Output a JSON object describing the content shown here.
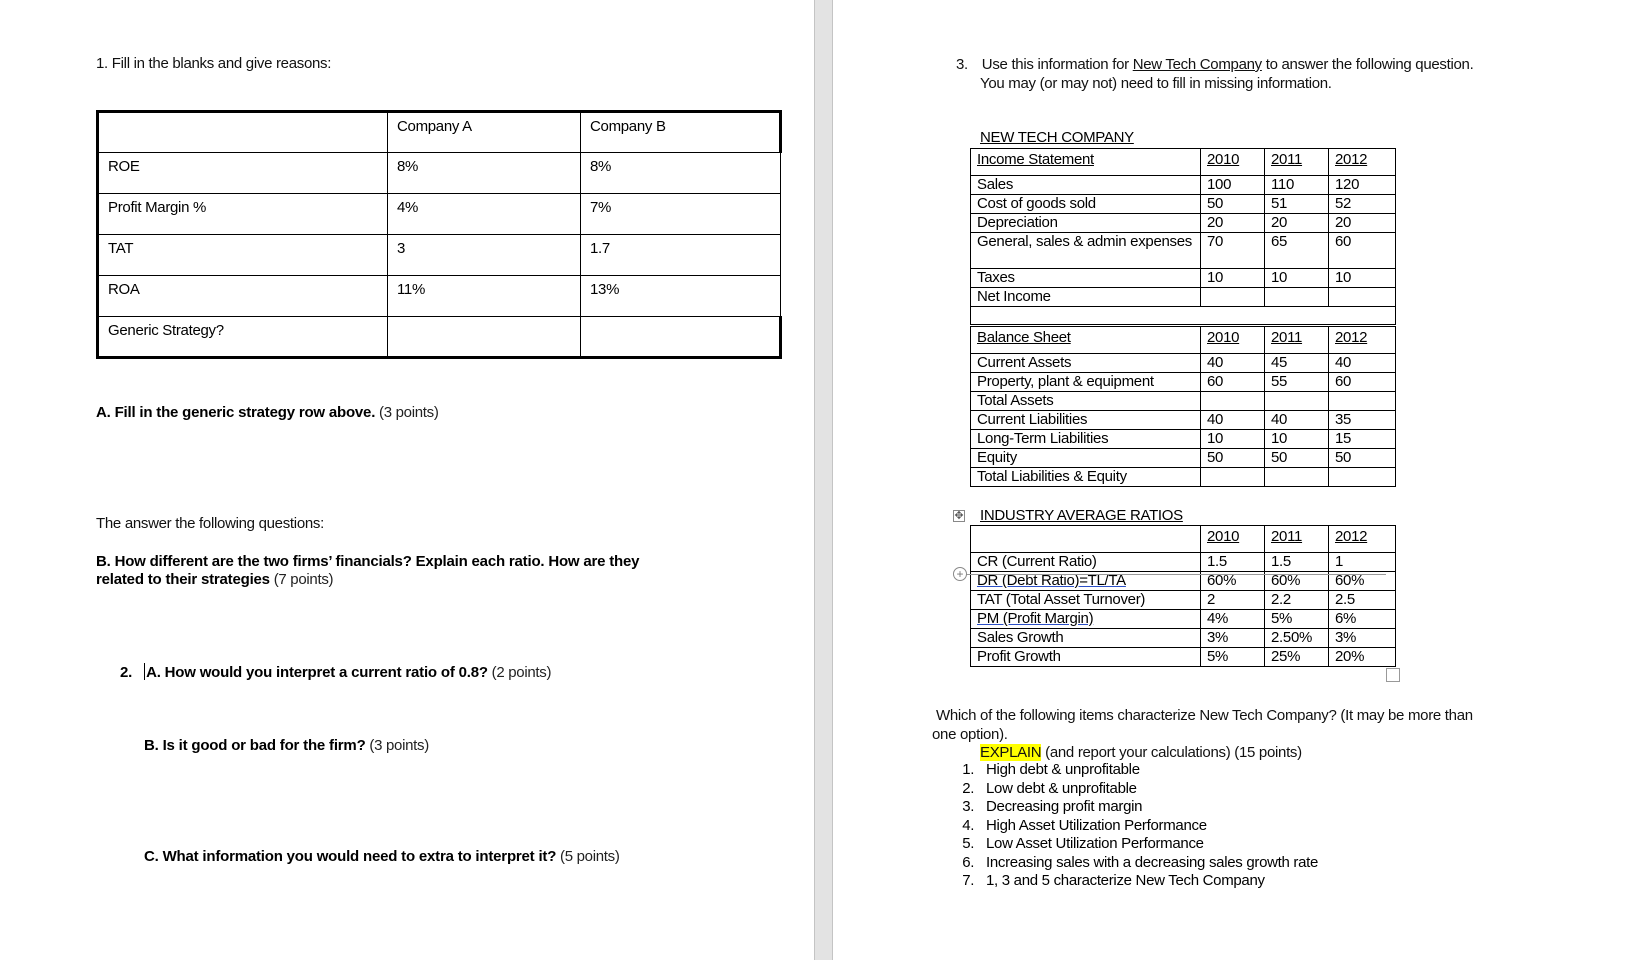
{
  "left_page": {
    "q1_heading": "1.  Fill in the blanks and give reasons:",
    "q1_table": {
      "headers": [
        "",
        "Company A",
        "Company B"
      ],
      "rows": [
        [
          "ROE",
          "8%",
          "8%"
        ],
        [
          "Profit Margin %",
          "4%",
          "7%"
        ],
        [
          "TAT",
          "3",
          "1.7"
        ],
        [
          "ROA",
          "11%",
          "13%"
        ],
        [
          "Generic Strategy?",
          "",
          ""
        ]
      ]
    },
    "q1a": {
      "bold": "A. Fill in the generic strategy row above.",
      "points": " (3 points)"
    },
    "intro": "The answer the following questions:",
    "q1b": {
      "bold_line1": "B. How different are the two firms’ financials? Explain each ratio. How are they",
      "bold_line2": "related to their  strategies",
      "points": " (7 points)"
    },
    "q2a": {
      "number": "2.",
      "bold": "A. How would you interpret  a current ratio of 0.8?",
      "points": "  (2 points)"
    },
    "q2b": {
      "bold": "B. Is it good or bad for the firm?",
      "points": " (3 points)"
    },
    "q2c": {
      "bold": "C. What information  you would need to extra to interpret it?",
      "points": " (5 points)"
    }
  },
  "right_page": {
    "q3_number": "3.",
    "q3_line1_pre": "Use this information for ",
    "q3_company_link": "New Tech Company",
    "q3_line1_post": " to answer the following question.",
    "q3_line2": "You may (or may not) need to fill in missing information.",
    "company_title": "NEW TECH COMPANY",
    "income_statement": {
      "headers": [
        "Income Statement",
        "2010",
        "2011",
        "2012"
      ],
      "rows": [
        [
          "Sales",
          "100",
          "110",
          "120"
        ],
        [
          "Cost of goods sold",
          "50",
          "51",
          "52"
        ],
        [
          "Depreciation",
          "20",
          "20",
          "20"
        ],
        [
          "General, sales & admin expenses",
          "70",
          "65",
          "60"
        ],
        [
          "Taxes",
          "10",
          "10",
          "10"
        ],
        [
          "Net Income",
          "",
          "",
          ""
        ]
      ]
    },
    "balance_sheet": {
      "headers": [
        "Balance Sheet",
        "2010",
        "2011",
        "2012"
      ],
      "rows": [
        [
          "Current Assets",
          "40",
          "45",
          "40"
        ],
        [
          "Property, plant & equipment",
          "60",
          "55",
          "60"
        ],
        [
          "Total  Assets",
          "",
          "",
          ""
        ],
        [
          "Current Liabilities",
          "40",
          "40",
          "35"
        ],
        [
          "Long-Term Liabilities",
          "10",
          "10",
          "15"
        ],
        [
          "Equity",
          "50",
          "50",
          "50"
        ],
        [
          "Total Liabilities & Equity",
          "",
          "",
          ""
        ]
      ]
    },
    "industry_title": "INDUSTRY AVERAGE RATIOS",
    "industry_ratios": {
      "headers": [
        "",
        "2010",
        "2011",
        "2012"
      ],
      "rows": [
        [
          "CR (Current Ratio)",
          "1.5",
          "1.5",
          "1"
        ],
        [
          "DR (Debt Ratio)=TL/TA",
          "60%",
          "60%",
          "60%"
        ],
        [
          "TAT (Total Asset Turnover)",
          "2",
          "2.2",
          "2.5"
        ],
        [
          "PM  (Profit Margin)",
          "4%",
          "5%",
          "6%"
        ],
        [
          "Sales Growth",
          "3%",
          "2.50%",
          "3%"
        ],
        [
          "Profit Growth",
          "5%",
          "25%",
          "20%"
        ]
      ]
    },
    "question_line1": "Which of the following items characterize New Tech Company?  (It may be more than",
    "question_line2": "one option).",
    "explain_highlight": "EXPLAIN",
    "explain_rest": " (and report your calculations) (15 points)",
    "options": [
      "High debt & unprofitable",
      "Low debt & unprofitable",
      "Decreasing profit margin",
      "High Asset Utilization Performance",
      "Low Asset Utilization Performance",
      "Increasing sales with a decreasing sales growth rate",
      "1, 3 and 5 characterize New Tech Company"
    ],
    "colors": {
      "highlight": "#ffff00",
      "gutter": "#e3e3e3"
    },
    "icons": {
      "table_move": "table-move-handle-icon",
      "row_insert": "row-insert-icon",
      "table_resize": "table-resize-handle-icon"
    }
  }
}
